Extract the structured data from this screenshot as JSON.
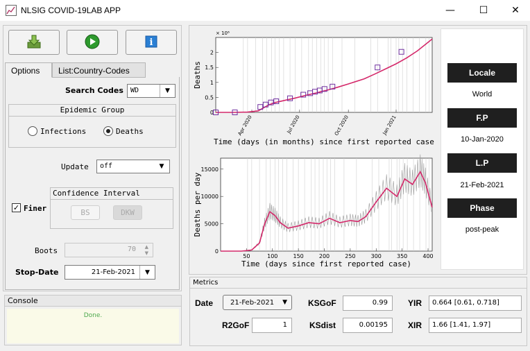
{
  "window": {
    "title": "NLSIG COVID-19LAB APP",
    "minimize": "—",
    "maximize": "☐",
    "close": "✕"
  },
  "toolbar": {
    "download_icon": "download-icon",
    "run_icon": "play-icon",
    "info_icon": "info-icon"
  },
  "tabs": [
    "Options",
    "List:Country-Codes"
  ],
  "options": {
    "search_codes_label": "Search Codes",
    "search_codes_value": "WD",
    "epidemic_group_title": "Epidemic Group",
    "radio_infections": "Infections",
    "radio_deaths": "Deaths",
    "update_label": "Update",
    "update_value": "off",
    "finer_label": "Finer",
    "ci_title": "Confidence Interval",
    "ci_bs": "BS",
    "ci_dkw": "DKW",
    "boots_label": "Boots",
    "boots_value": "70",
    "stop_date_label": "Stop-Date",
    "stop_date_value": "21-Feb-2021"
  },
  "console": {
    "title": "Console",
    "message": "Done."
  },
  "side_info": {
    "locale_label": "Locale",
    "locale_value": "World",
    "fp_label": "F.P",
    "fp_value": "10-Jan-2020",
    "lp_label": "L.P",
    "lp_value": "21-Feb-2021",
    "phase_label": "Phase",
    "phase_value": "post-peak"
  },
  "metrics": {
    "title": "Metrics",
    "date_label": "Date",
    "date_value": "21-Feb-2021",
    "ksgof_label": "KSGoF",
    "ksgof_value": "0.99",
    "yir_label": "YIR",
    "yir_value": "0.664 [0.61, 0.718]",
    "r2gof_label": "R2GoF",
    "r2gof_value": "1",
    "ksdist_label": "KSdist",
    "ksdist_value": "0.00195",
    "xir_label": "XIR",
    "xir_value": "1.66 [1.41, 1.97]"
  },
  "chart_data": [
    {
      "type": "line",
      "ylabel": "Deaths",
      "xlabel": "Time  (days (in months) since first reported case",
      "y_multiplier": "× 10⁶",
      "yticks": [
        0,
        0.5,
        1,
        1.5,
        2
      ],
      "ylim": [
        0,
        2.5
      ],
      "xticks": [
        "Apr 2020",
        "Jul 2020",
        "Oct 2020",
        "Jan 2021"
      ],
      "xlim": [
        0,
        408
      ],
      "x": [
        0,
        30,
        60,
        80,
        90,
        100,
        110,
        130,
        150,
        170,
        190,
        200,
        210,
        220,
        230,
        250,
        280,
        300,
        320,
        340,
        360,
        380,
        408
      ],
      "y": [
        0,
        0.0,
        0.01,
        0.05,
        0.15,
        0.25,
        0.32,
        0.4,
        0.48,
        0.57,
        0.65,
        0.7,
        0.74,
        0.79,
        0.84,
        0.95,
        1.12,
        1.28,
        1.45,
        1.62,
        1.82,
        2.05,
        2.45
      ],
      "markers_x": [
        0,
        36,
        84,
        94,
        104,
        114,
        140,
        165,
        178,
        187,
        196,
        205,
        220,
        305,
        350
      ],
      "markers_y": [
        0,
        0.0,
        0.18,
        0.26,
        0.33,
        0.37,
        0.47,
        0.59,
        0.64,
        0.69,
        0.73,
        0.78,
        0.86,
        1.5,
        2.02
      ]
    },
    {
      "type": "line",
      "ylabel": "Deaths per day",
      "xlabel": "Time  (days since first reported case)",
      "yticks": [
        0,
        5000,
        10000,
        15000
      ],
      "ylim": [
        0,
        17000
      ],
      "xticks": [
        50,
        100,
        150,
        200,
        250,
        300,
        350,
        400
      ],
      "xlim": [
        0,
        408
      ],
      "x": [
        0,
        40,
        60,
        75,
        85,
        95,
        105,
        115,
        130,
        150,
        170,
        190,
        210,
        230,
        250,
        265,
        280,
        300,
        320,
        340,
        355,
        370,
        385,
        395,
        408
      ],
      "y": [
        0,
        0,
        200,
        1500,
        5000,
        7200,
        6500,
        5200,
        4200,
        4600,
        5200,
        5000,
        6000,
        5200,
        5600,
        5400,
        6300,
        9000,
        11500,
        10000,
        13200,
        12200,
        14500,
        12500,
        8000
      ]
    }
  ]
}
